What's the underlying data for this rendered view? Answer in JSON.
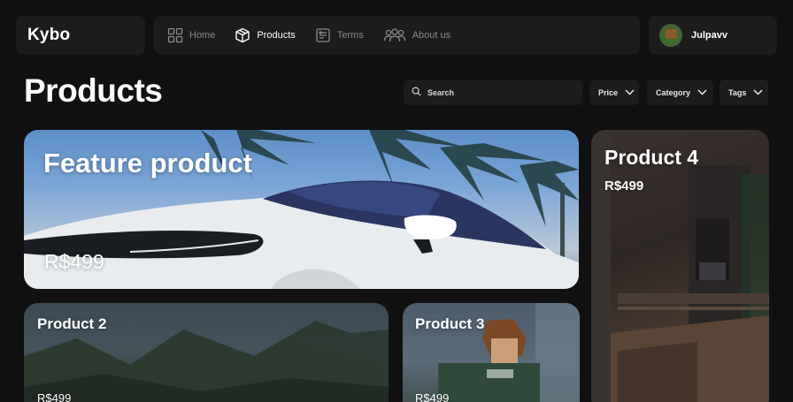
{
  "brand": {
    "name": "Kybo"
  },
  "nav": {
    "items": [
      {
        "label": "Home",
        "icon": "grid-icon",
        "active": false
      },
      {
        "label": "Products",
        "icon": "box-icon",
        "active": true
      },
      {
        "label": "Terms",
        "icon": "document-icon",
        "active": false
      },
      {
        "label": "About us",
        "icon": "people-icon",
        "active": false
      }
    ]
  },
  "user": {
    "name": "Julpavv"
  },
  "page": {
    "title": "Products"
  },
  "filters": {
    "search_placeholder": "Search",
    "price_label": "Price",
    "category_label": "Category",
    "tags_label": "Tags"
  },
  "products": {
    "featured": {
      "name": "Feature product",
      "price": "R$499"
    },
    "product_2": {
      "name": "Product 2",
      "price": "R$499"
    },
    "product_3": {
      "name": "Product 3",
      "price": "R$499"
    },
    "product_4": {
      "name": "Product 4",
      "price": "R$499"
    }
  },
  "colors": {
    "background": "#111111",
    "panel": "#1c1c1c",
    "text_primary": "#ffffff",
    "text_muted": "#8a8a8a"
  }
}
